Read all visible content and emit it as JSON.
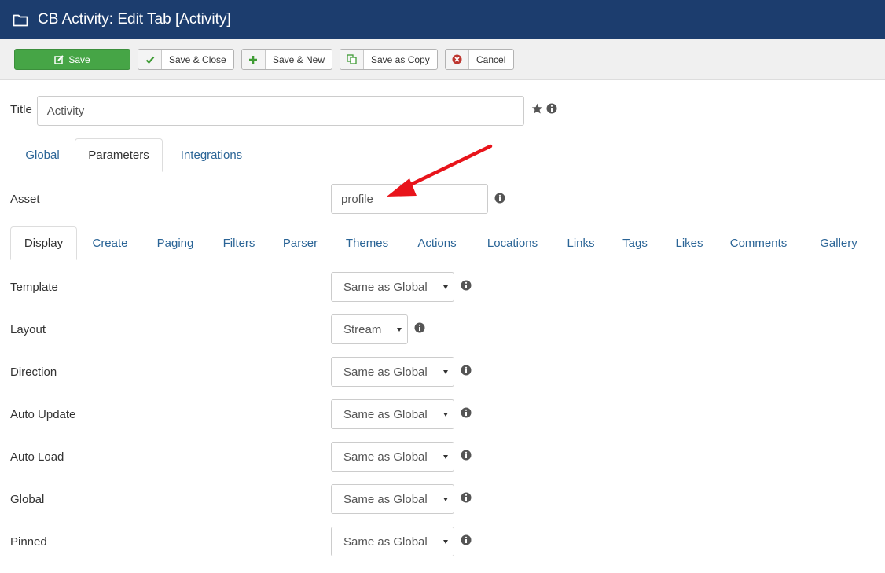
{
  "header": {
    "title": "CB Activity: Edit Tab [Activity]"
  },
  "toolbar": {
    "save": "Save",
    "save_close": "Save & Close",
    "save_new": "Save & New",
    "save_copy": "Save as Copy",
    "cancel": "Cancel"
  },
  "title_field": {
    "label": "Title",
    "value": "Activity"
  },
  "main_tabs": [
    "Global",
    "Parameters",
    "Integrations"
  ],
  "asset": {
    "label": "Asset",
    "value": "profile"
  },
  "sub_tabs": [
    "Display",
    "Create",
    "Paging",
    "Filters",
    "Parser",
    "Themes",
    "Actions",
    "Locations",
    "Links",
    "Tags",
    "Likes",
    "Comments",
    "Gallery"
  ],
  "settings": [
    {
      "label": "Template",
      "value": "Same as Global"
    },
    {
      "label": "Layout",
      "value": "Stream"
    },
    {
      "label": "Direction",
      "value": "Same as Global"
    },
    {
      "label": "Auto Update",
      "value": "Same as Global"
    },
    {
      "label": "Auto Load",
      "value": "Same as Global"
    },
    {
      "label": "Global",
      "value": "Same as Global"
    },
    {
      "label": "Pinned",
      "value": "Same as Global"
    }
  ],
  "colors": {
    "header_bg": "#1c3d6e",
    "save_green": "#46a546",
    "link_blue": "#2a6496",
    "annotation_red": "#e8141b"
  }
}
